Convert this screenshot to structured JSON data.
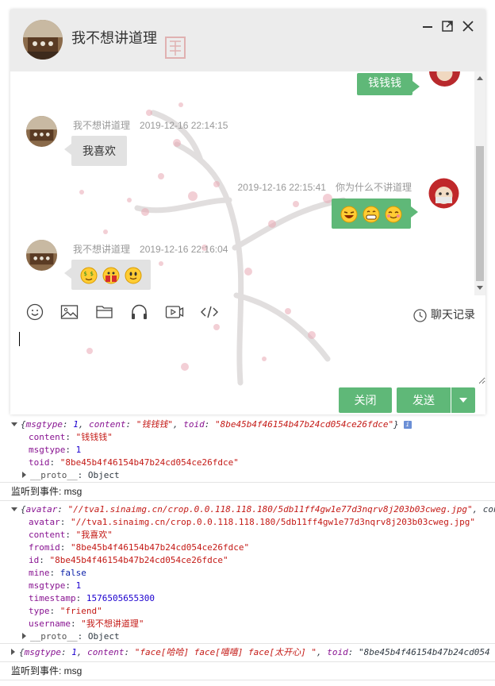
{
  "chat": {
    "title": "我不想讲道理",
    "partial_message": "钱钱钱",
    "messages": [
      {
        "side": "left",
        "username": "我不想讲道理",
        "time": "2019-12-16 22:14:15",
        "text": "我喜欢"
      },
      {
        "side": "right",
        "username": "你为什么不讲道理",
        "time": "2019-12-16 22:15:41",
        "faces": [
          "laugh-face-icon",
          "grin-face-icon",
          "happy-face-icon"
        ]
      },
      {
        "side": "left",
        "username": "我不想讲道理",
        "time": "2019-12-16 22:16:04",
        "faces": [
          "money-face-icon",
          "gift-face-icon",
          "smile-face-icon"
        ]
      }
    ],
    "toolbar": {
      "tools": [
        "emoji-icon",
        "image-icon",
        "folder-icon",
        "headphones-icon",
        "video-icon",
        "code-icon"
      ],
      "history_label": "聊天记录"
    },
    "input_value": "",
    "buttons": {
      "close": "关闭",
      "send": "发送"
    },
    "colors": {
      "accent": "#5fb878",
      "header_bg": "#ececec",
      "bubble_left": "#e2e2e2"
    }
  },
  "console": {
    "log1": {
      "summary": "{msgtype: 1, content: \"钱钱钱\", toid: \"8be45b4f46154b47b24cd054ce26fdce\"}",
      "content": "\"钱钱钱\"",
      "msgtype": "1",
      "toid": "\"8be45b4f46154b47b24cd054ce26fdce\""
    },
    "event1": "监听到事件: msg",
    "log2": {
      "summary": "{avatar: \"//tva1.sinaimg.cn/crop.0.0.118.118.180/5db11ff4gw1e77d3nqrv8j203b03cweg.jpg\", con",
      "avatar": "\"//tva1.sinaimg.cn/crop.0.0.118.118.180/5db11ff4gw1e77d3nqrv8j203b03cweg.jpg\"",
      "content": "\"我喜欢\"",
      "fromid": "\"8be45b4f46154b47b24cd054ce26fdce\"",
      "id": "\"8be45b4f46154b47b24cd054ce26fdce\"",
      "mine": "false",
      "msgtype": "1",
      "timestamp": "1576505655300",
      "type": "\"friend\"",
      "username": "\"我不想讲道理\""
    },
    "log3": {
      "summary": "{msgtype: 1, content: \"face[哈哈] face[嘻嘻] face[太开心] \", toid: \"8be45b4f46154b47b24cd054"
    },
    "event2": "监听到事件: msg",
    "proto_key": "__proto__",
    "proto_val": "Object"
  }
}
